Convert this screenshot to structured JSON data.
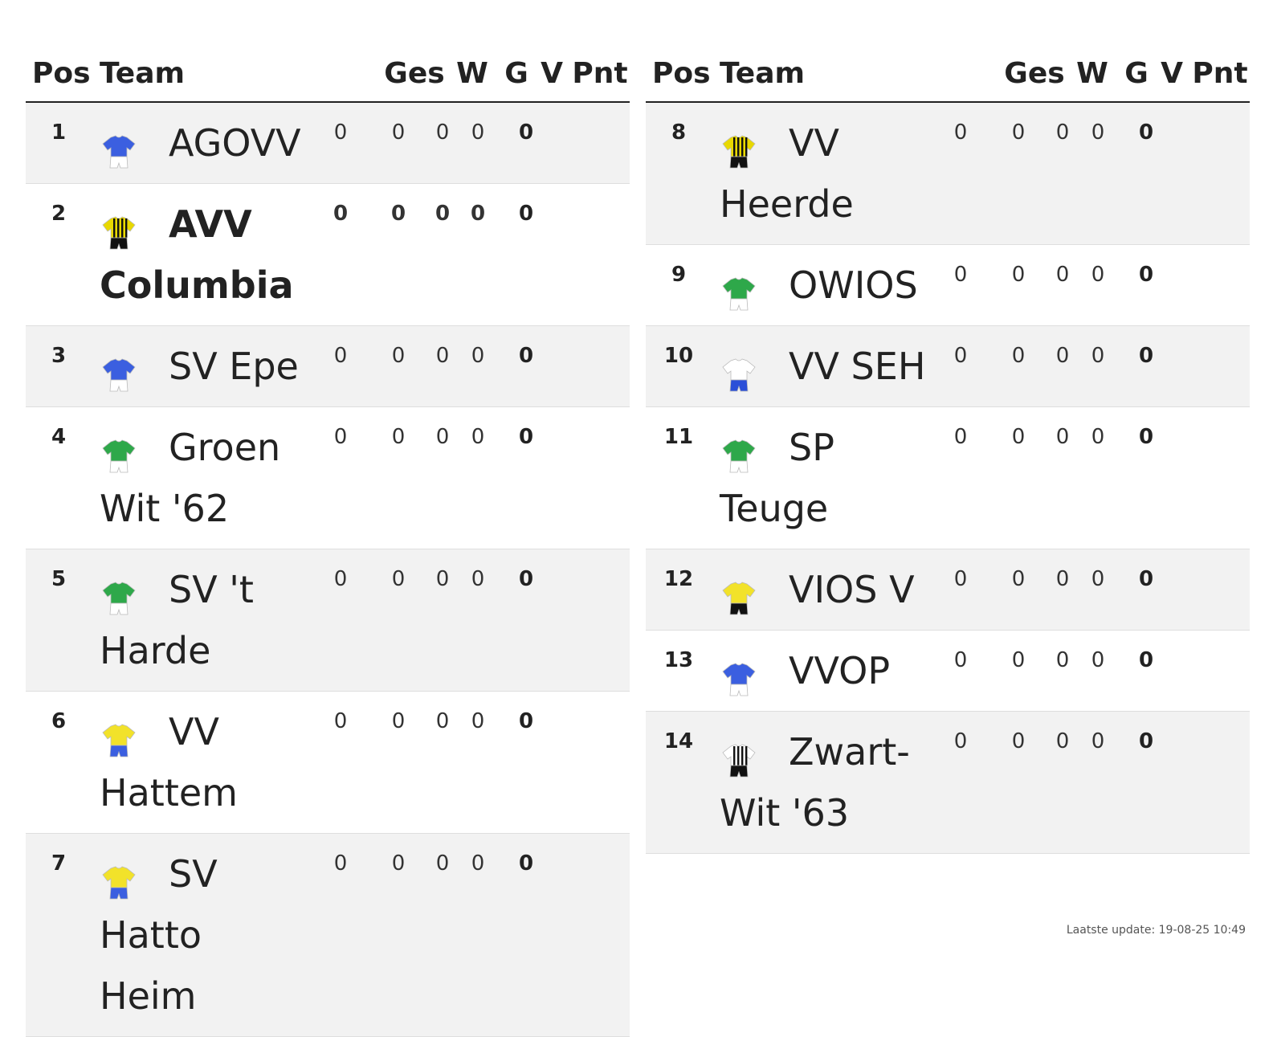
{
  "headers": {
    "pos": "Pos",
    "team": "Team",
    "ges": "Ges",
    "w": "W",
    "g": "G",
    "v": "V",
    "pnt": "Pnt"
  },
  "left": [
    {
      "pos": "1",
      "team": "AGOVV",
      "ges": "0",
      "w": "0",
      "g": "0",
      "v": "0",
      "pnt": "0",
      "shirt": {
        "top": "#3b5fe0",
        "stripe": "",
        "shorts": "#ffffff",
        "kind": "plain"
      },
      "bold": false
    },
    {
      "pos": "2",
      "team": "AVV Columbia",
      "ges": "0",
      "w": "0",
      "g": "0",
      "v": "0",
      "pnt": "0",
      "shirt": {
        "top": "#e8d800",
        "stripe": "#111111",
        "shorts": "#111111",
        "kind": "stripes"
      },
      "bold": true
    },
    {
      "pos": "3",
      "team": "SV Epe",
      "ges": "0",
      "w": "0",
      "g": "0",
      "v": "0",
      "pnt": "0",
      "shirt": {
        "top": "#3b5fe0",
        "stripe": "",
        "shorts": "#ffffff",
        "kind": "plain"
      },
      "bold": false
    },
    {
      "pos": "4",
      "team": "Groen Wit '62",
      "ges": "0",
      "w": "0",
      "g": "0",
      "v": "0",
      "pnt": "0",
      "shirt": {
        "top": "#2ea84a",
        "stripe": "",
        "shorts": "#ffffff",
        "kind": "plain"
      },
      "bold": false
    },
    {
      "pos": "5",
      "team": "SV 't Harde",
      "ges": "0",
      "w": "0",
      "g": "0",
      "v": "0",
      "pnt": "0",
      "shirt": {
        "top": "#2ea84a",
        "stripe": "",
        "shorts": "#ffffff",
        "kind": "plain"
      },
      "bold": false
    },
    {
      "pos": "6",
      "team": "VV Hattem",
      "ges": "0",
      "w": "0",
      "g": "0",
      "v": "0",
      "pnt": "0",
      "shirt": {
        "top": "#f2e22a",
        "stripe": "",
        "shorts": "#3b5fe0",
        "kind": "plain"
      },
      "bold": false
    },
    {
      "pos": "7",
      "team": "SV Hatto Heim",
      "ges": "0",
      "w": "0",
      "g": "0",
      "v": "0",
      "pnt": "0",
      "shirt": {
        "top": "#f2e22a",
        "stripe": "",
        "shorts": "#3b5fe0",
        "kind": "plain"
      },
      "bold": false
    }
  ],
  "right": [
    {
      "pos": "8",
      "team": "VV Heerde",
      "ges": "0",
      "w": "0",
      "g": "0",
      "v": "0",
      "pnt": "0",
      "shirt": {
        "top": "#e8d800",
        "stripe": "#111111",
        "shorts": "#111111",
        "kind": "stripes"
      },
      "bold": false
    },
    {
      "pos": "9",
      "team": "OWIOS",
      "ges": "0",
      "w": "0",
      "g": "0",
      "v": "0",
      "pnt": "0",
      "shirt": {
        "top": "#2ea84a",
        "stripe": "",
        "shorts": "#ffffff",
        "kind": "plain"
      },
      "bold": false
    },
    {
      "pos": "10",
      "team": "VV SEH",
      "ges": "0",
      "w": "0",
      "g": "0",
      "v": "0",
      "pnt": "0",
      "shirt": {
        "top": "#ffffff",
        "stripe": "",
        "shorts": "#2b4fd8",
        "kind": "plain"
      },
      "bold": false
    },
    {
      "pos": "11",
      "team": "SP Teuge",
      "ges": "0",
      "w": "0",
      "g": "0",
      "v": "0",
      "pnt": "0",
      "shirt": {
        "top": "#2ea84a",
        "stripe": "",
        "shorts": "#ffffff",
        "kind": "plain"
      },
      "bold": false
    },
    {
      "pos": "12",
      "team": "VIOS V",
      "ges": "0",
      "w": "0",
      "g": "0",
      "v": "0",
      "pnt": "0",
      "shirt": {
        "top": "#f2e22a",
        "stripe": "",
        "shorts": "#111111",
        "kind": "plain"
      },
      "bold": false
    },
    {
      "pos": "13",
      "team": "VVOP",
      "ges": "0",
      "w": "0",
      "g": "0",
      "v": "0",
      "pnt": "0",
      "shirt": {
        "top": "#3b5fe0",
        "stripe": "",
        "shorts": "#ffffff",
        "kind": "plain"
      },
      "bold": false
    },
    {
      "pos": "14",
      "team": "Zwart-Wit '63",
      "ges": "0",
      "w": "0",
      "g": "0",
      "v": "0",
      "pnt": "0",
      "shirt": {
        "top": "#ffffff",
        "stripe": "#111111",
        "shorts": "#111111",
        "kind": "stripes"
      },
      "bold": false
    }
  ],
  "footer": {
    "update": "Laatste update: 19-08-25 10:49"
  }
}
